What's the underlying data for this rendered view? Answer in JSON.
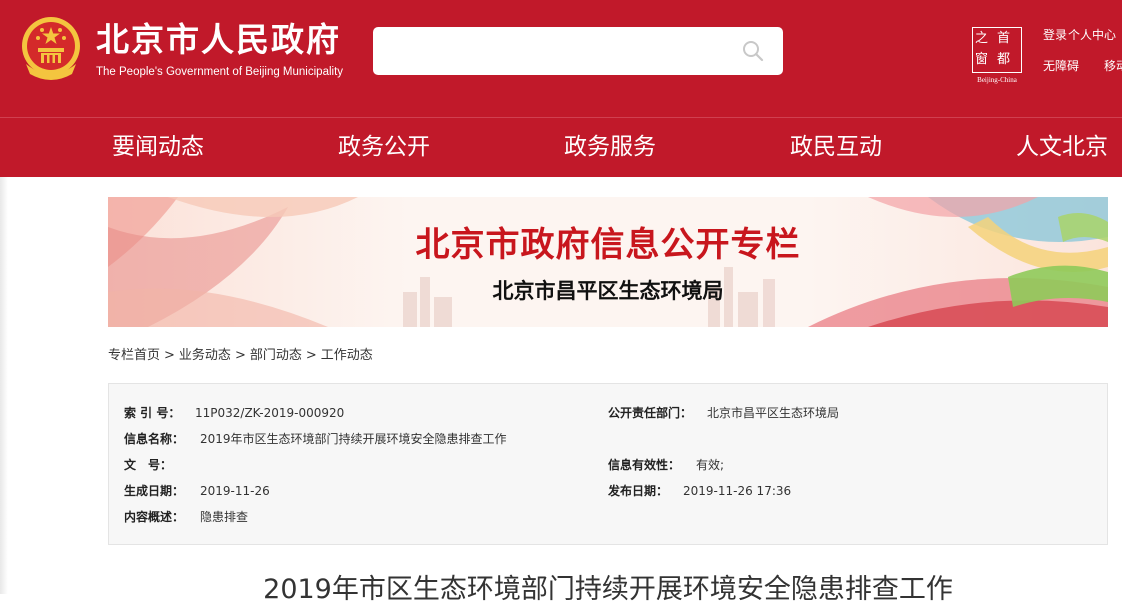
{
  "header": {
    "title": "北京市人民政府",
    "subtitle": "The People's Government of Beijing Municipality",
    "search": {
      "value": "",
      "placeholder": ""
    },
    "logo": {
      "cells": [
        "之",
        "首",
        "窗",
        "都"
      ],
      "caption": "Beijing-China"
    },
    "links": {
      "login": "登录",
      "personal_center": "个人中心",
      "accessibility": "无障碍",
      "mobile": "移动"
    }
  },
  "nav": {
    "items": [
      "要闻动态",
      "政务公开",
      "政务服务",
      "政民互动",
      "人文北京"
    ]
  },
  "banner": {
    "title": "北京市政府信息公开专栏",
    "subtitle": "北京市昌平区生态环境局"
  },
  "breadcrumb": {
    "items": [
      "专栏首页",
      "业务动态",
      "部门动态",
      "工作动态"
    ],
    "separator": ">"
  },
  "info": {
    "index_label": "索 引 号：",
    "index_value": "11P032/ZK-2019-000920",
    "dept_label": "公开责任部门：",
    "dept_value": "北京市昌平区生态环境局",
    "name_label": "信息名称：",
    "name_value": "2019年市区生态环境部门持续开展环境安全隐患排查工作",
    "doc_label": "文　号：",
    "doc_value": "",
    "validity_label": "信息有效性：",
    "validity_value": "有效;",
    "gen_date_label": "生成日期：",
    "gen_date_value": "2019-11-26",
    "pub_date_label": "发布日期：",
    "pub_date_value": "2019-11-26 17:36",
    "summary_label": "内容概述：",
    "summary_value": "隐患排查"
  },
  "article": {
    "title": "2019年市区生态环境部门持续开展环境安全隐患排查工作"
  },
  "colors": {
    "brand_red": "#c1192a",
    "gold": "#f4c53f",
    "banner_title_red": "#c8161d"
  },
  "icons": {
    "emblem": "national-emblem-icon",
    "search": "search-icon"
  }
}
